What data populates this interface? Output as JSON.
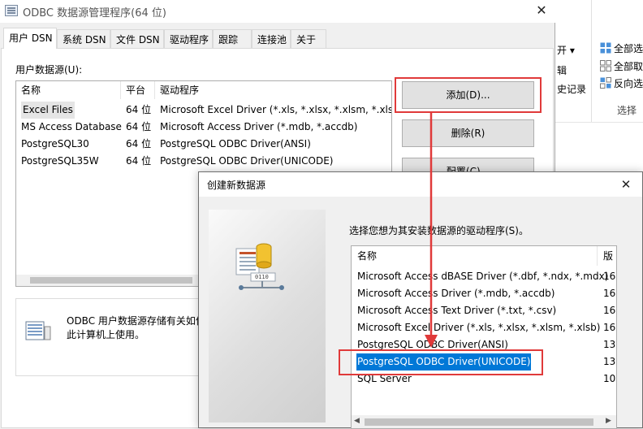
{
  "background_window": {
    "ribbon": {
      "open_label": "开 ▾",
      "edit_label": "辑",
      "history_label": "史记录",
      "select_all": "全部选",
      "select_none": "全部取",
      "invert_selection": "反向选",
      "group_label": "选择"
    }
  },
  "odbc_window": {
    "title": "ODBC 数据源管理程序(64 位)",
    "close_glyph": "✕",
    "tabs": [
      "用户 DSN",
      "系统 DSN",
      "文件 DSN",
      "驱动程序",
      "跟踪",
      "连接池",
      "关于"
    ],
    "user_dsn_label": "用户数据源(U):",
    "columns": {
      "name": "名称",
      "platform": "平台",
      "driver": "驱动程序"
    },
    "rows": [
      {
        "name": "Excel Files",
        "platform": "64 位",
        "driver": "Microsoft Excel Driver (*.xls, *.xlsx, *.xlsm, *.xlsb)"
      },
      {
        "name": "MS Access Database",
        "platform": "64 位",
        "driver": "Microsoft Access Driver (*.mdb, *.accdb)"
      },
      {
        "name": "PostgreSQL30",
        "platform": "64 位",
        "driver": "PostgreSQL ODBC Driver(ANSI)"
      },
      {
        "name": "PostgreSQL35W",
        "platform": "64 位",
        "driver": "PostgreSQL ODBC Driver(UNICODE)"
      }
    ],
    "buttons": {
      "add": "添加(D)...",
      "remove": "删除(R)",
      "configure": "配置(C)..."
    },
    "info_text_line1": "ODBC 用户数据源存储有关如何",
    "info_text_line2": "此计算机上使用。"
  },
  "create_dialog": {
    "title": "创建新数据源",
    "close_glyph": "✕",
    "prompt": "选择您想为其安装数据源的驱动程序(S)。",
    "columns": {
      "name": "名称",
      "version": "版"
    },
    "drivers": [
      {
        "name": "Microsoft Access dBASE Driver (*.dbf, *.ndx, *.mdx)",
        "version": "16"
      },
      {
        "name": "Microsoft Access Driver (*.mdb, *.accdb)",
        "version": "16"
      },
      {
        "name": "Microsoft Access Text Driver (*.txt, *.csv)",
        "version": "16"
      },
      {
        "name": "Microsoft Excel Driver (*.xls, *.xlsx, *.xlsm, *.xlsb)",
        "version": "16"
      },
      {
        "name": "PostgreSQL ODBC Driver(ANSI)",
        "version": "13"
      },
      {
        "name": "PostgreSQL ODBC Driver(UNICODE)",
        "version": "13"
      },
      {
        "name": "SQL Server",
        "version": "10"
      }
    ],
    "selected_driver": "PostgreSQL ODBC Driver(UNICODE)",
    "art_label": "0110"
  },
  "colors": {
    "highlight_red": "#e03a3a",
    "selection_blue": "#0078d7"
  }
}
